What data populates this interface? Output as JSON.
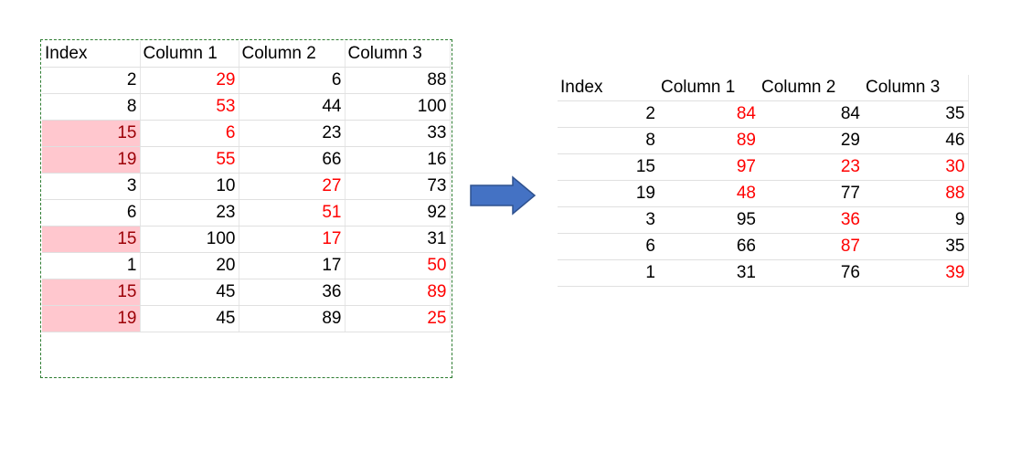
{
  "colors": {
    "highlight_fill": "#ffc7ce",
    "highlight_text": "#9c0006",
    "red_text": "#ff0000",
    "arrow_fill": "#4472c4",
    "marquee_border": "#2e7d32"
  },
  "left_table": {
    "headers": [
      "Index",
      "Column 1",
      "Column 2",
      "Column 3"
    ],
    "rows": [
      [
        "2",
        "29",
        "6",
        "88"
      ],
      [
        "8",
        "53",
        "44",
        "100"
      ],
      [
        "15",
        "6",
        "23",
        "33"
      ],
      [
        "19",
        "55",
        "66",
        "16"
      ],
      [
        "3",
        "10",
        "27",
        "73"
      ],
      [
        "6",
        "23",
        "51",
        "92"
      ],
      [
        "15",
        "100",
        "17",
        "31"
      ],
      [
        "1",
        "20",
        "17",
        "50"
      ],
      [
        "15",
        "45",
        "36",
        "89"
      ],
      [
        "19",
        "45",
        "89",
        "25"
      ]
    ]
  },
  "arrow_icon": "right-arrow",
  "right_table": {
    "headers": [
      "Index",
      "Column 1",
      "Column 2",
      "Column 3"
    ],
    "rows": [
      [
        "2",
        "84",
        "84",
        "35"
      ],
      [
        "8",
        "89",
        "29",
        "46"
      ],
      [
        "15",
        "97",
        "23",
        "30"
      ],
      [
        "19",
        "48",
        "77",
        "88"
      ],
      [
        "3",
        "95",
        "36",
        "9"
      ],
      [
        "6",
        "66",
        "87",
        "35"
      ],
      [
        "1",
        "31",
        "76",
        "39"
      ]
    ]
  }
}
